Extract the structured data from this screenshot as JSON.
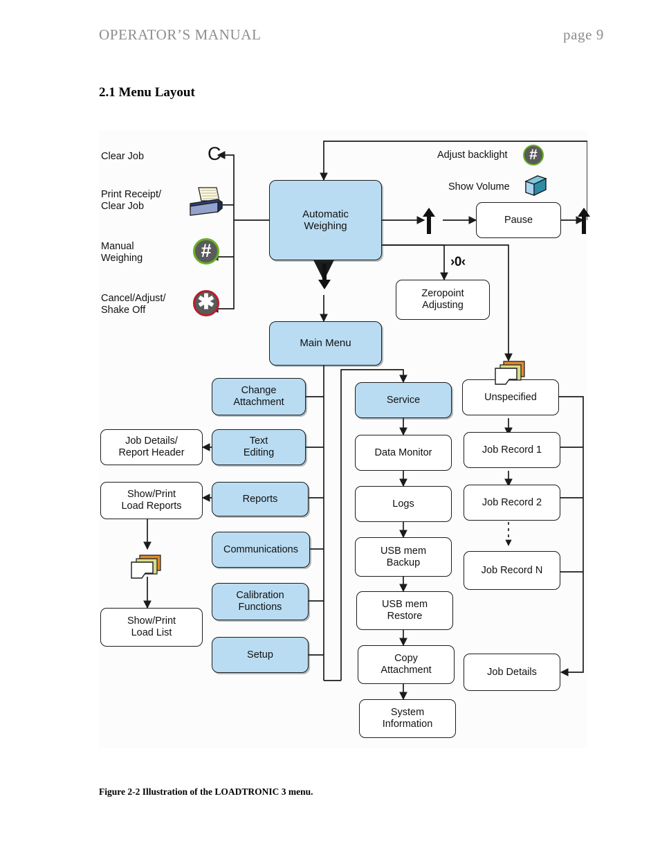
{
  "header": {
    "manual_title": "OPERATOR’S MANUAL",
    "page_number": "page 9"
  },
  "section": {
    "title": "2.1 Menu Layout"
  },
  "figure": {
    "caption": "Figure 2-2 Illustration of the LOADTRONIC 3 menu."
  },
  "diagram": {
    "legend_left": [
      {
        "label": "Clear Job",
        "icon": "letter-c-key-icon"
      },
      {
        "label": "Print Receipt/\nClear Job",
        "icon": "printer-icon"
      },
      {
        "label": "Manual\nWeighing",
        "icon": "hash-key-green-icon"
      },
      {
        "label": "Cancel/Adjust/\nShake Off",
        "icon": "asterisk-key-red-icon"
      }
    ],
    "legend_right": [
      {
        "label": "Adjust backlight",
        "icon": "hash-key-green-icon"
      },
      {
        "label": "Show Volume",
        "icon": "cube-icon"
      }
    ],
    "glyphs": {
      "clear_key": "C",
      "zeropoint_key": "›0‹"
    },
    "nodes": {
      "automatic_weighing": "Automatic\nWeighing",
      "pause": "Pause",
      "zeropoint_adjusting": "Zeropoint\nAdjusting",
      "main_menu": "Main Menu",
      "change_attachment": "Change\nAttachment",
      "text_editing": "Text\nEditing",
      "reports": "Reports",
      "communications": "Communications",
      "calibration_functions": "Calibration\nFunctions",
      "setup": "Setup",
      "job_details_report_header": "Job Details/\nReport Header",
      "show_print_load_reports": "Show/Print\nLoad Reports",
      "show_print_load_list": "Show/Print\nLoad List",
      "service": "Service",
      "data_monitor": "Data Monitor",
      "logs": "Logs",
      "usb_mem_backup": "USB mem\nBackup",
      "usb_mem_restore": "USB mem\nRestore",
      "copy_attachment": "Copy\nAttachment",
      "system_information": "System\nInformation",
      "unspecified": "Unspecified",
      "job_record_1": "Job Record 1",
      "job_record_2": "Job Record 2",
      "job_record_n": "Job Record N",
      "job_details": "Job Details"
    },
    "colors": {
      "node_blue": "#b9dcf2",
      "node_white": "#ffffff",
      "stroke": "#1b1b1b",
      "icon_green": "#66b024",
      "icon_red": "#b51f2a",
      "icon_gray": "#5a5a5a",
      "cube_front": "#a8d4ef",
      "cube_top": "#49a8c4",
      "printer_body": "#2b3f7a",
      "doc_back": "#e08a30",
      "doc_mid": "#d9dd8a"
    }
  }
}
